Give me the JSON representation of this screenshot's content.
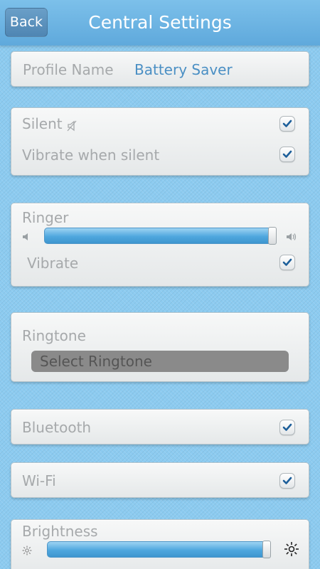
{
  "header": {
    "back_label": "Back",
    "title": "Central Settings"
  },
  "profile": {
    "label": "Profile Name",
    "value": "Battery Saver"
  },
  "silent_section": {
    "silent_label": "Silent",
    "silent_checked": true,
    "vibrate_silent_label": "Vibrate when silent",
    "vibrate_silent_checked": true
  },
  "ringer": {
    "label": "Ringer",
    "level": 1.0,
    "vibrate_label": "Vibrate",
    "vibrate_checked": true
  },
  "ringtone": {
    "label": "Ringtone",
    "button_label": "Select Ringtone"
  },
  "bluetooth": {
    "label": "Bluetooth",
    "checked": true
  },
  "wifi": {
    "label": "Wi-Fi",
    "checked": true
  },
  "brightness": {
    "label": "Brightness",
    "level": 1.0
  },
  "colors": {
    "accent": "#4a8fc4",
    "label": "#a6a9ab",
    "check": "#1d5f9a"
  },
  "icons": {
    "silent": "muted-speaker-icon",
    "volume_low": "speaker-low-icon",
    "volume_high": "speaker-high-icon",
    "brightness_low": "sun-small-icon",
    "brightness_high": "sun-large-icon",
    "check": "checkmark-icon"
  }
}
